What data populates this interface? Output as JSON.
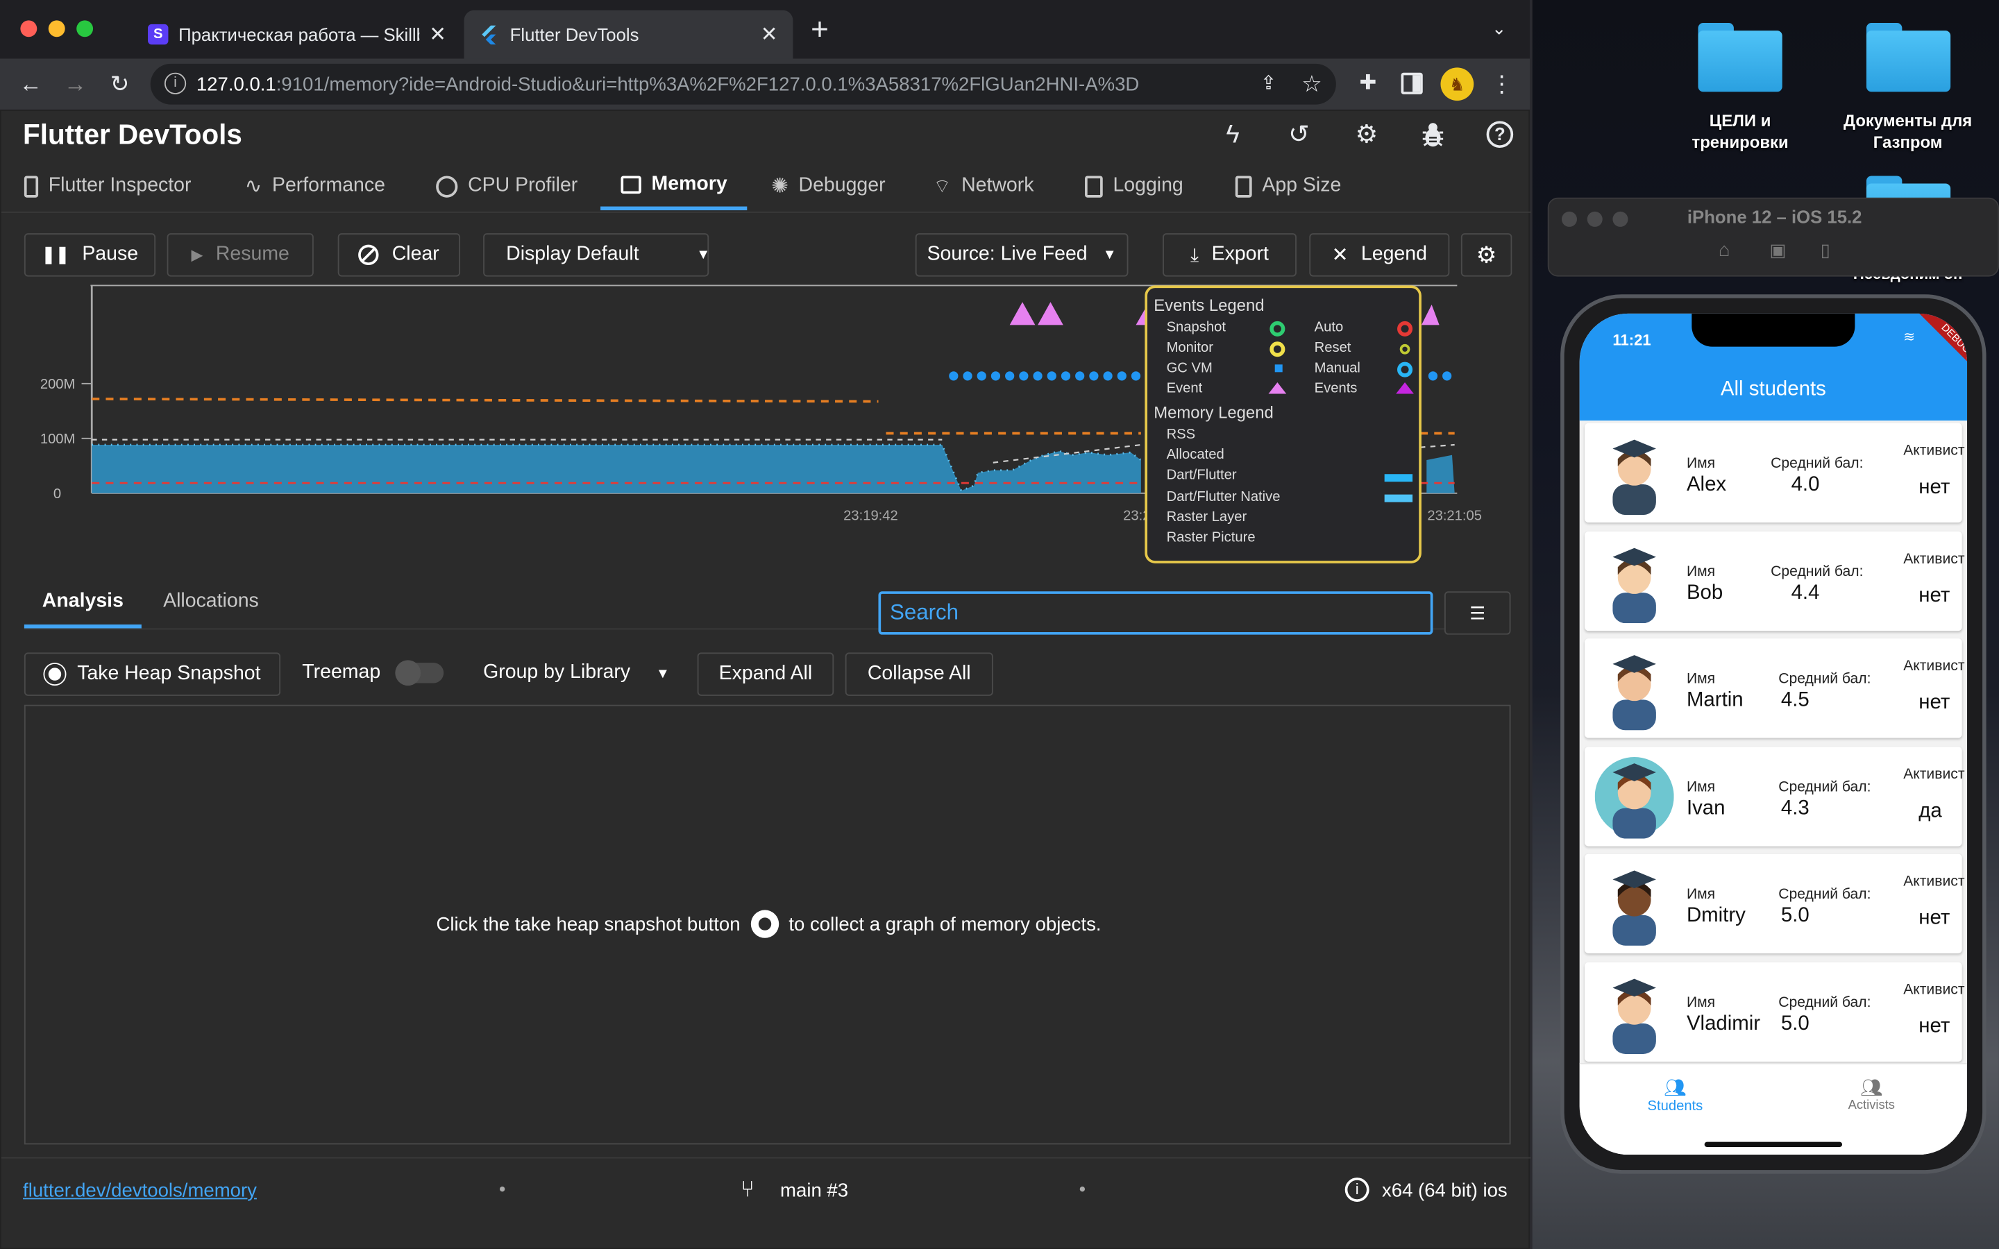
{
  "browser": {
    "tabs": [
      {
        "label": "Практическая работа — Skillb",
        "favicon": "S"
      },
      {
        "label": "Flutter DevTools"
      }
    ],
    "url_host": "127.0.0.1",
    "url_rest": ":9101/memory?ide=Android-Studio&uri=http%3A%2F%2F127.0.0.1%3A58317%2FlGUan2HNI-A%3D"
  },
  "app": {
    "title": "Flutter DevTools",
    "tabs": [
      "Flutter Inspector",
      "Performance",
      "CPU Profiler",
      "Memory",
      "Debugger",
      "Network",
      "Logging",
      "App Size"
    ],
    "active_tab": "Memory"
  },
  "toolbar": {
    "pause": "Pause",
    "resume": "Resume",
    "clear": "Clear",
    "display": "Display Default",
    "source": "Source: Live Feed",
    "export": "Export",
    "legend": "Legend"
  },
  "chart_data": {
    "type": "area",
    "y_ticks": [
      "200M",
      "100M",
      "0"
    ],
    "x_ticks": [
      "23:19:42",
      "23:2",
      "23:21:05"
    ],
    "series": [
      {
        "name": "Dart/Flutter",
        "color": "#2e8fc0"
      },
      {
        "name": "RSS",
        "color": "#e67e22"
      },
      {
        "name": "Allocated",
        "color": "#cfcfcf"
      }
    ]
  },
  "legend": {
    "events_title": "Events Legend",
    "events": [
      {
        "label": "Snapshot",
        "color": "#2ecc71"
      },
      {
        "label": "Auto",
        "color": "#e53935"
      },
      {
        "label": "Monitor",
        "color": "#f1e04a"
      },
      {
        "label": "Reset",
        "color": "#c0ca33"
      },
      {
        "label": "GC VM",
        "color": "#2196f3"
      },
      {
        "label": "Manual",
        "color": "#29b6f6"
      },
      {
        "label": "Event",
        "color": "#e681f0"
      },
      {
        "label": "Events",
        "color": "#c526e0"
      }
    ],
    "memory_title": "Memory Legend",
    "memory": [
      "RSS",
      "Allocated",
      "Dart/Flutter",
      "Dart/Flutter Native",
      "Raster Layer",
      "Raster Picture"
    ]
  },
  "analysis": {
    "tabs": [
      "Analysis",
      "Allocations"
    ],
    "search_placeholder": "Search",
    "take_snapshot": "Take Heap Snapshot",
    "treemap": "Treemap",
    "group_by": "Group by Library",
    "expand_all": "Expand All",
    "collapse_all": "Collapse All",
    "message_before": "Click the take heap snapshot button",
    "message_after": "to collect a graph of memory objects."
  },
  "status": {
    "link": "flutter.dev/devtools/memory",
    "branch": "main #3",
    "platform": "x64 (64 bit) ios"
  },
  "desktop": {
    "folders": [
      "ЦЕЛИ и тренировки",
      "Документы для Газпром"
    ],
    "partial_label": "Псевдоним оп"
  },
  "simulator": {
    "title": "iPhone 12 – iOS 15.2",
    "time": "11:21",
    "debug_banner": "DEBUG",
    "appbar_title": "All students",
    "name_label": "Имя",
    "grade_label": "Средний бал:",
    "activist_label": "Активист",
    "students": [
      {
        "name": "Alex",
        "grade": "4.0",
        "activist": "нет"
      },
      {
        "name": "Bob",
        "grade": "4.4",
        "activist": "нет"
      },
      {
        "name": "Martin",
        "grade": "4.5",
        "activist": "нет"
      },
      {
        "name": "Ivan",
        "grade": "4.3",
        "activist": "да"
      },
      {
        "name": "Dmitry",
        "grade": "5.0",
        "activist": "нет"
      },
      {
        "name": "Vladimir",
        "grade": "5.0",
        "activist": "нет"
      }
    ],
    "nav": [
      {
        "label": "Students",
        "active": true
      },
      {
        "label": "Activists",
        "active": false
      }
    ]
  }
}
